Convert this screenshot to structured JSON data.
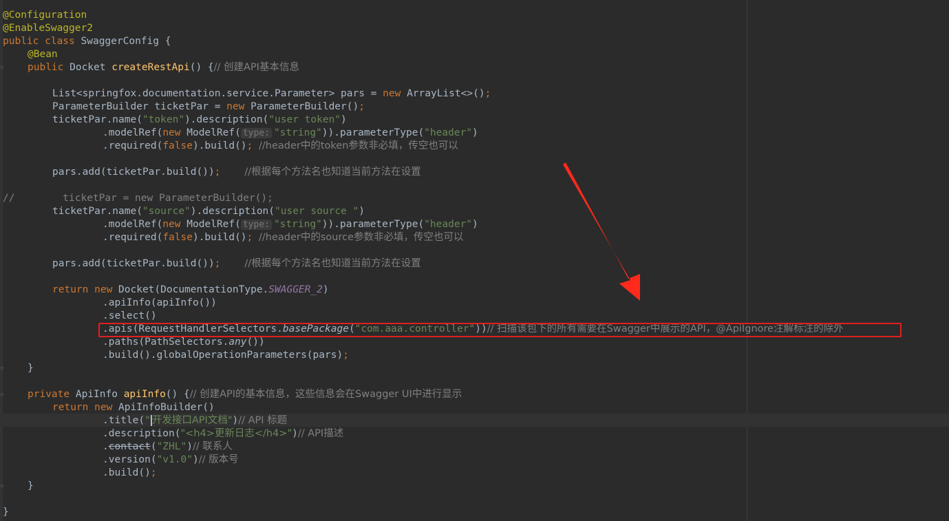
{
  "colors": {
    "background": "#2b2b2b",
    "keyword": "#cc7832",
    "annotation": "#bbb529",
    "method_declaration": "#ffc66d",
    "string": "#6a8759",
    "comment": "#808080",
    "static_field": "#9876aa",
    "highlight_box": "#e02020",
    "arrow": "#ff2a1a"
  },
  "code": {
    "l1_ann": "@Configuration",
    "l2_ann": "@EnableSwagger2",
    "l3_kw": "public class ",
    "l3_rest": "SwaggerConfig {",
    "l4_ann": "@Bean",
    "l5_kw": "public ",
    "l5_type": "Docket ",
    "l5_fn": "createRestApi",
    "l5_rest": "() {",
    "l5_cmt": "// 创建API基本信息",
    "l7_pre": "List<springfox.documentation.service.Parameter> pars = ",
    "l7_kw": "new ",
    "l7_rest": "ArrayList<>()",
    "l7_semi": ";",
    "l8_pre": "ParameterBuilder ticketPar = ",
    "l8_kw": "new ",
    "l8_rest": "ParameterBuilder()",
    "l8_semi": ";",
    "l9_pre": "ticketPar.name(",
    "l9_s1": "\"token\"",
    "l9_mid": ").description(",
    "l9_s2": "\"user token\"",
    "l9_end": ")",
    "l10_pre": ".modelRef(",
    "l10_kw": "new ",
    "l10_mid": "ModelRef(",
    "l10_hint": "type:",
    "l10_s1": "\"string\"",
    "l10_mid2": ")).parameterType(",
    "l10_s2": "\"header\"",
    "l10_end": ")",
    "l11_pre": ".required(",
    "l11_kw": "false",
    "l11_mid": ").build()",
    "l11_semi": "; ",
    "l11_cmt": "//header中的token参数非必填，传空也可以",
    "l13_code": "pars.add(ticketPar.build())",
    "l13_semi": ";    ",
    "l13_cmt": "//根据每个方法名也知道当前方法在设置",
    "l15_cmt": "//        ticketPar = new ParameterBuilder();",
    "l16_pre": "ticketPar.name(",
    "l16_s1": "\"source\"",
    "l16_mid": ").description(",
    "l16_s2": "\"user source \"",
    "l16_end": ")",
    "l17_pre": ".modelRef(",
    "l17_kw": "new ",
    "l17_mid": "ModelRef(",
    "l17_hint": "type:",
    "l17_s1": "\"string\"",
    "l17_mid2": ")).parameterType(",
    "l17_s2": "\"header\"",
    "l17_end": ")",
    "l18_pre": ".required(",
    "l18_kw": "false",
    "l18_mid": ").build()",
    "l18_semi": "; ",
    "l18_cmt": "//header中的source参数非必填，传空也可以",
    "l20_code": "pars.add(ticketPar.build())",
    "l20_semi": ";    ",
    "l20_cmt": "//根据每个方法名也知道当前方法在设置",
    "l22_kw": "return new ",
    "l22_mid": "Docket(DocumentationType.",
    "l22_field": "SWAGGER_2",
    "l22_end": ")",
    "l23": ".apiInfo(apiInfo())",
    "l24": ".select()",
    "l25_pre": ".apis(RequestHandlerSelectors.",
    "l25_ital": "basePackage",
    "l25_open": "(",
    "l25_s": "\"com.aaa.controller\"",
    "l25_close": "))",
    "l25_cmt": "// 扫描该包下的所有需要在Swagger中展示的API，@ApiIgnore注解标注的除外",
    "l26_pre": ".paths(PathSelectors.",
    "l26_ital": "any",
    "l26_end": "())",
    "l27_code": ".build().globalOperationParameters(pars)",
    "l27_semi": ";",
    "l28": "}",
    "l30_kw": "private ",
    "l30_type": "ApiInfo ",
    "l30_fn": "apiInfo",
    "l30_rest": "() {",
    "l30_cmt": "// 创建API的基本信息，这些信息会在Swagger UI中进行显示",
    "l31_kw": "return new ",
    "l31_rest": "ApiInfoBuilder()",
    "l32_pre": ".title(",
    "l32_q": "\"",
    "l32_s": "开发接口API文档\"",
    "l32_end": ")",
    "l32_cmt": "// API 标题",
    "l33_pre": ".description(",
    "l33_s": "\"<h4>更新日志</h4>\"",
    "l33_end": ")",
    "l33_cmt": "// API描述",
    "l34_dot": ".",
    "l34_strike": "contact",
    "l34_open": "(",
    "l34_s": "\"ZHL\"",
    "l34_end": ")",
    "l34_cmt": "// 联系人",
    "l35_pre": ".version(",
    "l35_s": "\"v1.0\"",
    "l35_end": ")",
    "l35_cmt": "// 版本号",
    "l36_code": ".build()",
    "l36_semi": ";",
    "l37": "}",
    "l39": "}"
  }
}
